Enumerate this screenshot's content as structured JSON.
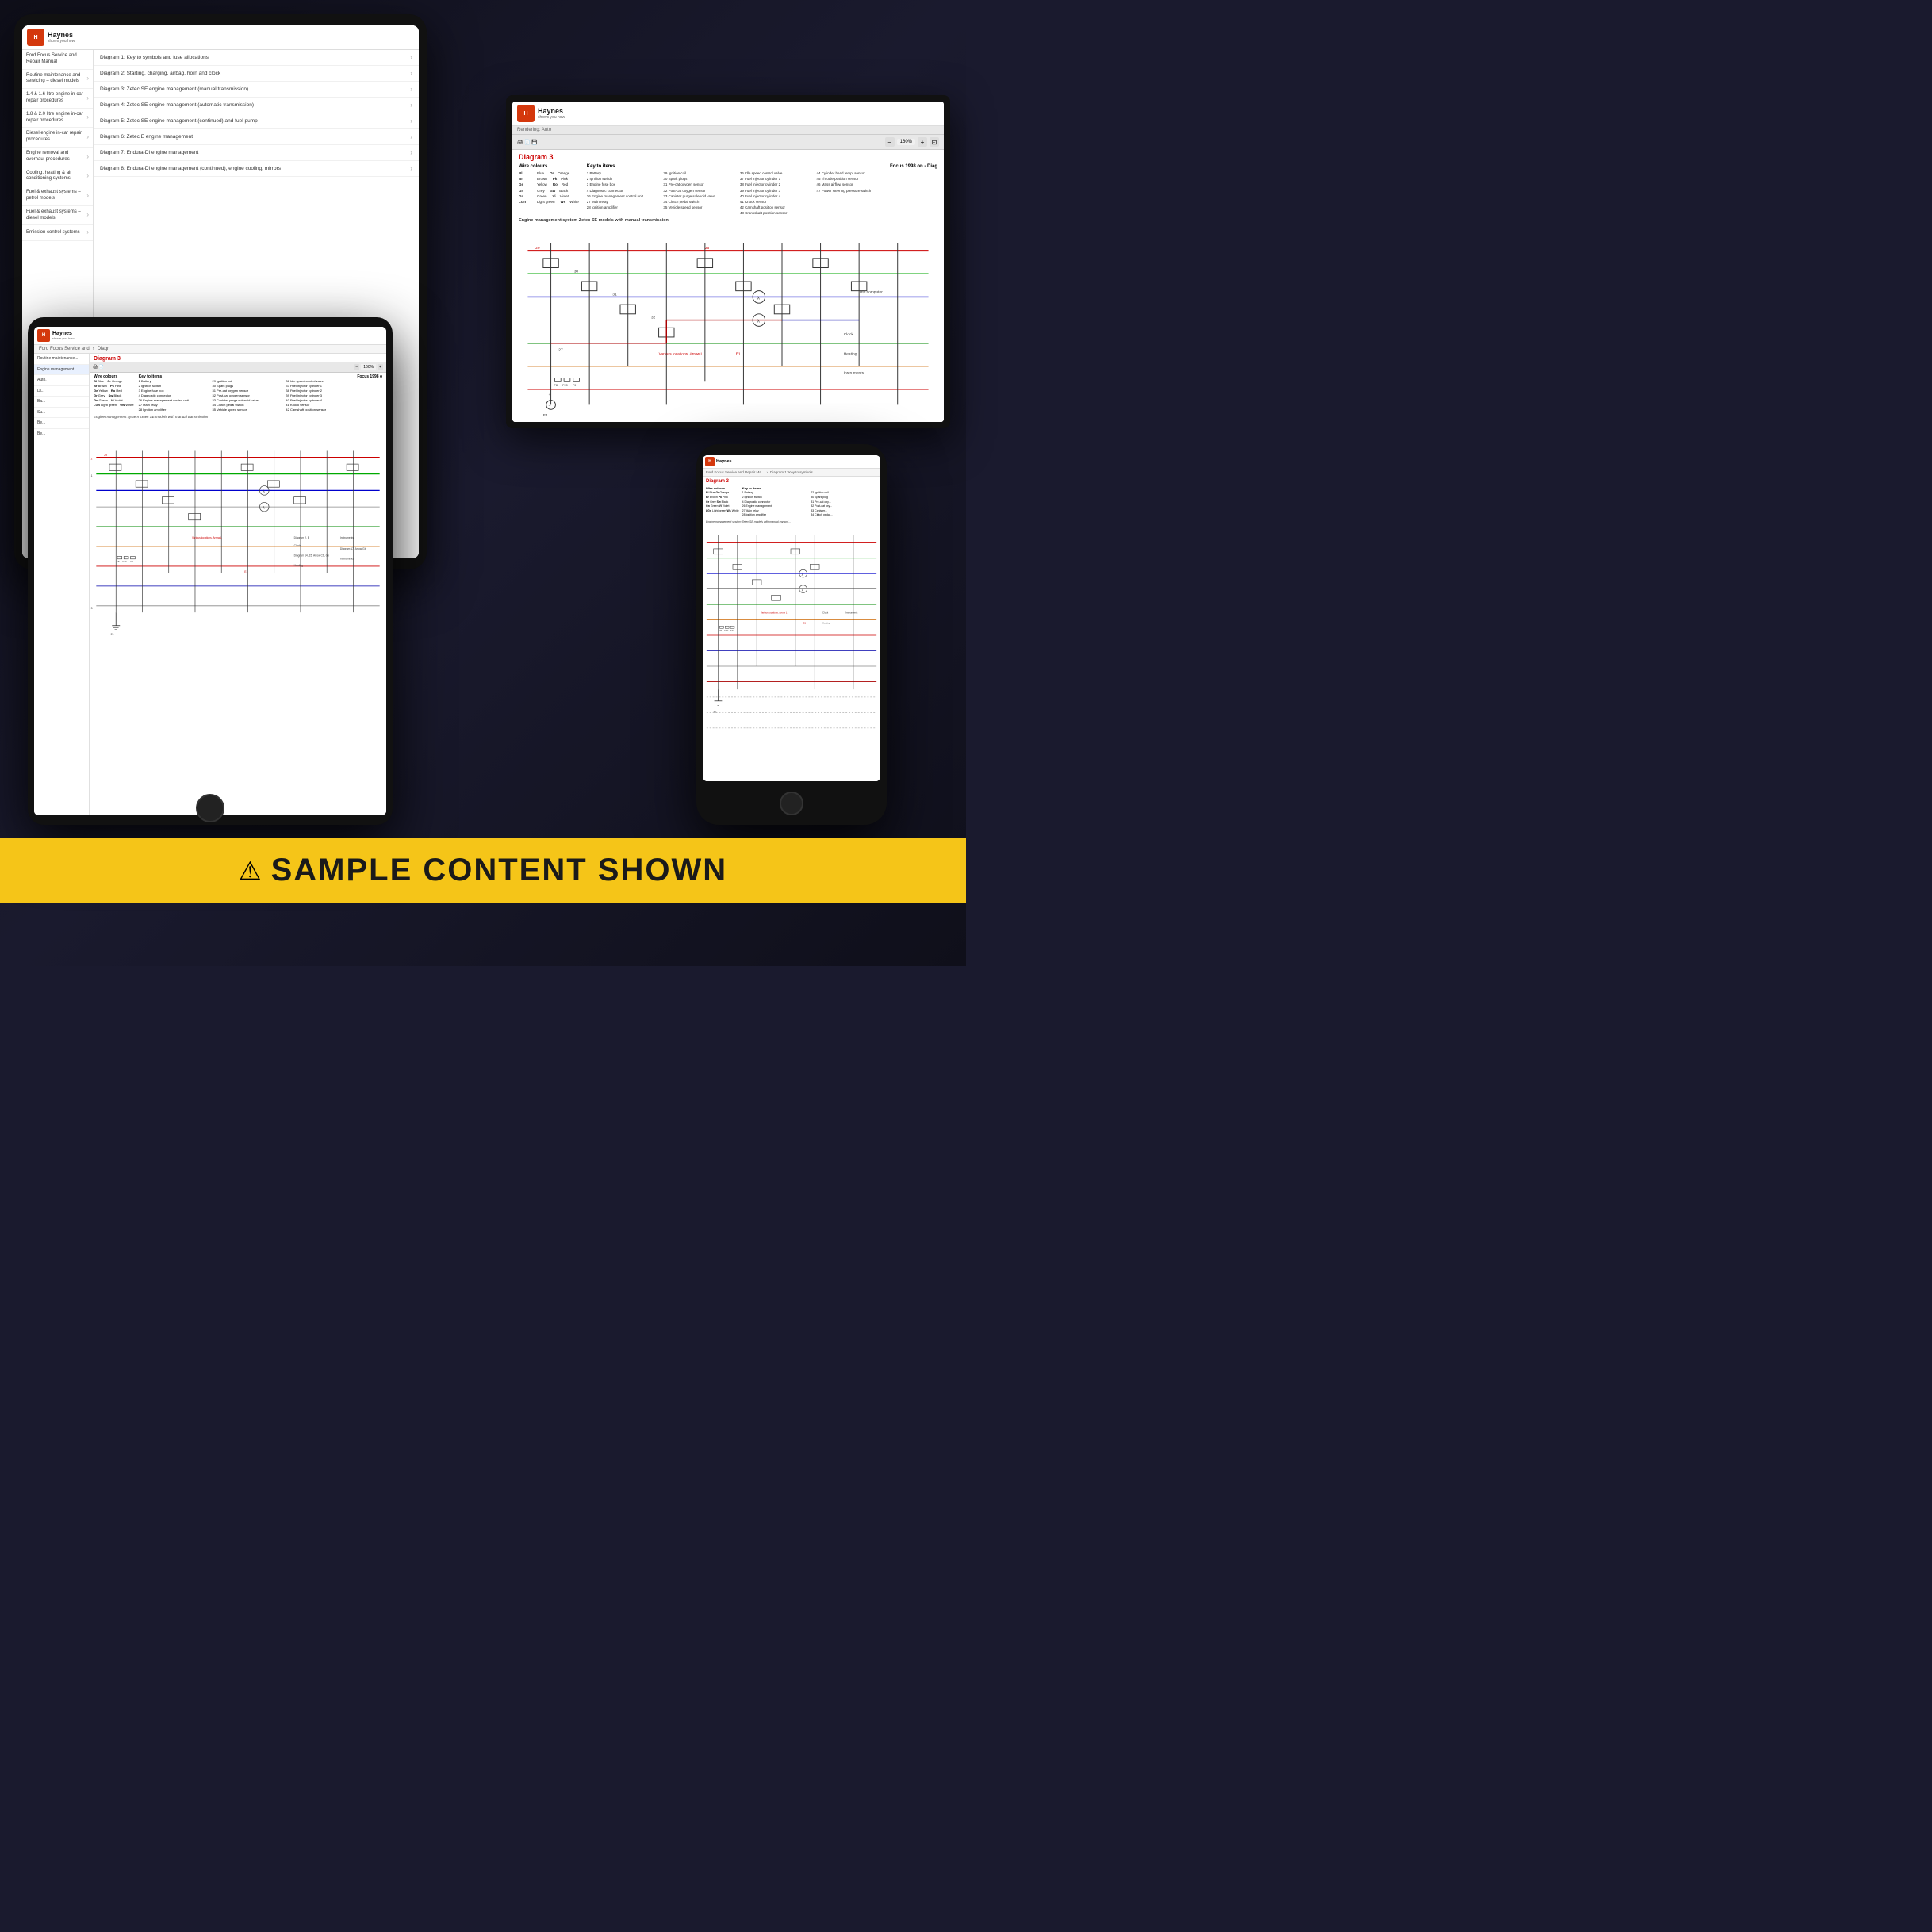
{
  "app": {
    "name": "Haynes",
    "tagline": "shows you how",
    "book_title": "Ford Focus Service and Repair Manual",
    "brand_color": "#d4380d",
    "sample_banner": {
      "icon": "⚠",
      "text": "SAMPLE CONTENT SHOWN"
    }
  },
  "sidebar": {
    "items": [
      {
        "id": "routine",
        "label": "Routine maintenance and servicing – diesel models",
        "active": false
      },
      {
        "id": "engine14",
        "label": "1.4 & 1.6 litre engine in-car repair procedures",
        "active": false
      },
      {
        "id": "engine18",
        "label": "1.8 & 2.0 litre engine in-car repair procedures",
        "active": false
      },
      {
        "id": "diesel",
        "label": "Diesel engine in-car repair procedures",
        "active": false
      },
      {
        "id": "overhaul",
        "label": "Engine removal and overhaul procedures",
        "active": false
      },
      {
        "id": "cooling",
        "label": "Cooling, heating & air conditioning systems",
        "active": false
      },
      {
        "id": "fuel_petrol",
        "label": "Fuel & exhaust systems – petrol models",
        "active": false
      },
      {
        "id": "fuel_diesel",
        "label": "Fuel & exhaust systems – diesel models",
        "active": false
      },
      {
        "id": "emission",
        "label": "Emission control systems",
        "active": false
      }
    ]
  },
  "diagrams": {
    "items": [
      {
        "id": "d1",
        "label": "Diagram 1: Key to symbols and fuse allocations",
        "active": true
      },
      {
        "id": "d2",
        "label": "Diagram 2: Starting, charging, airbag, horn and clock"
      },
      {
        "id": "d3",
        "label": "Diagram 3: Zetec SE engine management (manual transmission)"
      },
      {
        "id": "d4",
        "label": "Diagram 4: Zetec SE engine management (automatic transmission)"
      },
      {
        "id": "d5",
        "label": "Diagram 5: Zetec SE engine management (continued) and fuel pump"
      },
      {
        "id": "d6",
        "label": "Diagram 6: Zetec E engine management"
      },
      {
        "id": "d7",
        "label": "Diagram 7: Endura-DI engine management"
      },
      {
        "id": "d8",
        "label": "Diagram 8: Endura-DI engine management (continued), engine cooling, mirrors"
      }
    ]
  },
  "diagram3": {
    "title": "Diagram 3",
    "subtitle": "Engine management system Zetec SE models with manual transmission",
    "focus_header": "Focus 1998 on - Diag",
    "rendering_label": "Rendering: Auto",
    "zoom": "160%",
    "wire_colours_heading": "Wire colours",
    "key_to_items_heading": "Key to items",
    "wire_colours": [
      {
        "abbr": "Bl",
        "name": "Blue"
      },
      {
        "abbr": "Br",
        "name": "Brown"
      },
      {
        "abbr": "Ge",
        "name": "Yellow"
      },
      {
        "abbr": "Gn",
        "name": "Grey"
      },
      {
        "abbr": "Gn",
        "name": "Green"
      },
      {
        "abbr": "LGn",
        "name": "Light green"
      }
    ],
    "wire_colours2": [
      {
        "abbr": "Or",
        "name": "Orange"
      },
      {
        "abbr": "Pk",
        "name": "Pink"
      },
      {
        "abbr": "Ro",
        "name": "Red"
      },
      {
        "abbr": "Sw",
        "name": "Black"
      },
      {
        "abbr": "Vi",
        "name": "Violet"
      },
      {
        "abbr": "Ws",
        "name": "White"
      }
    ],
    "key_items": [
      "1 Battery",
      "2 Ignition switch",
      "3 Engine fuse box",
      "4 Diagnostic connector",
      "26 Engine management control unit",
      "27 Main relay",
      "28 Ignition amplifier"
    ],
    "key_items2": [
      "29 Ignition coil",
      "30 Spark plugs",
      "31 Pre-cat oxygen sensor",
      "32 Post-cat oxygen sensor",
      "33 Canister purge solenoid valve",
      "34 Clutch pedal switch",
      "35 Vehicle speed sensor"
    ],
    "key_items3": [
      "36 Idle speed control valve",
      "37 Fuel injector cylinder 1",
      "38 Fuel injector cylinder 2",
      "39 Fuel injector cylinder 3",
      "40 Fuel injector cylinder 4",
      "41 Knock sensor",
      "42 Camshaft position sensor",
      "43 Crankshaft position sensor"
    ],
    "key_items4": [
      "44 Cylinder head temp. sensor",
      "45 Throttle position sensor",
      "46 Mass airflow sensor",
      "47 Power steering pressure switch"
    ]
  },
  "breadcrumb": {
    "items": [
      "Ford Focus Service and",
      "Diagr"
    ]
  }
}
